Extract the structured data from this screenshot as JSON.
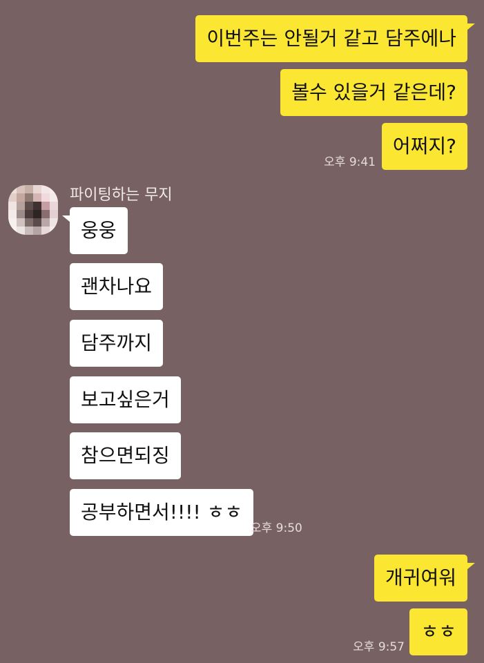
{
  "messages_out_1": {
    "lines": [
      "이번주는 안될거 같고 담주에나",
      "볼수 있을거 같은데?",
      "어쩌지?"
    ],
    "time": "오후 9:41"
  },
  "contact": {
    "name": "파이팅하는 무지"
  },
  "messages_in": {
    "lines": [
      "웅웅",
      "괜차나요",
      "담주까지",
      "보고싶은거",
      "참으면되징",
      "공부하면서!!!! ㅎㅎ"
    ],
    "time": "오후 9:50"
  },
  "messages_out_2": {
    "lines": [
      "개귀여워",
      "ㅎㅎ"
    ],
    "time": "오후 9:57"
  },
  "colors": {
    "background": "#786162",
    "outgoing_bubble": "#fbe632",
    "incoming_bubble": "#ffffff"
  },
  "avatar": {
    "icon": "pixelated-profile-photo",
    "pixels": [
      "#ede1dd",
      "#d9c2ba",
      "#c7b0a8",
      "#e8d6d2",
      "#f3e6e6",
      "#f6eef0",
      "#e3cfc8",
      "#c4a79f",
      "#8f7a74",
      "#d3b6b3",
      "#f0dadd",
      "#f4e9eb",
      "#efe4e1",
      "#b5a29d",
      "#5f4d4c",
      "#3f3131",
      "#c49ea2",
      "#ead5d8",
      "#f3ebea",
      "#9d8b89",
      "#4a3c3c",
      "#2d2424",
      "#8a6d70",
      "#e4d0d3",
      "#f6f0ef",
      "#cfc2bf",
      "#7d6e6c",
      "#5c4b4b",
      "#b9a7a8",
      "#efe4e6",
      "#f8f3f2",
      "#ece4e2",
      "#c9bcba",
      "#b4a4a4",
      "#e5d9d9",
      "#f5eeee"
    ]
  }
}
